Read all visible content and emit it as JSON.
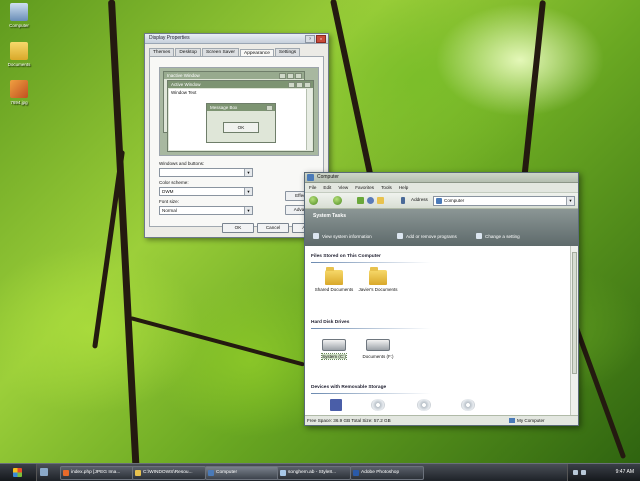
{
  "desktop": {
    "icons": [
      {
        "label": "Computer",
        "name": "computer-icon"
      },
      {
        "label": "Documents",
        "name": "documents-icon"
      },
      {
        "label": "7694.jpg",
        "name": "image-file-icon"
      }
    ]
  },
  "display_dialog": {
    "title": "Display Properties",
    "tabs": [
      "Themes",
      "Desktop",
      "Screen Saver",
      "Appearance",
      "Settings"
    ],
    "active_tab": "Appearance",
    "preview": {
      "inactive_title": "Inactive Window",
      "active_title": "Active Window",
      "window_text": "Window Text",
      "message_title": "Message Box",
      "ok": "OK"
    },
    "fields": {
      "windows_buttons_label": "Windows and buttons:",
      "windows_buttons_value": "",
      "color_scheme_label": "Color scheme:",
      "color_scheme_value": "DWM",
      "font_size_label": "Font size:",
      "font_size_value": "Normal"
    },
    "effects_label": "Effects...",
    "advanced_label": "Advanced",
    "ok": "OK",
    "cancel": "Cancel",
    "apply": "Apply"
  },
  "computer_window": {
    "title": "Computer",
    "menu": [
      "File",
      "Edit",
      "View",
      "Favorites",
      "Tools",
      "Help"
    ],
    "address_label": "Address",
    "address_value": "Computer",
    "system_tasks": {
      "heading": "System Tasks",
      "items": [
        "View system information",
        "Add or remove programs",
        "Change a setting"
      ]
    },
    "sections": {
      "files_heading": "Files Stored on This Computer",
      "files": [
        "Shared Documents",
        "Javier's Documents"
      ],
      "drives_heading": "Hard Disk Drives",
      "drives": [
        "System (C:)",
        "Documents (F:)"
      ],
      "removable_heading": "Devices with Removable Storage"
    },
    "status_left": "Free Space: 36.9 GB Total Size: 57.2 GB",
    "status_right": "My Computer"
  },
  "taskbar": {
    "buttons": [
      "index.php [JPEG Ima...",
      "C:\\WINDOWS\\Resou...",
      "Computer",
      "songhem.ab - Style8...",
      "Adobe Photoshop"
    ],
    "active_index": 2,
    "clock": "9:47 AM"
  }
}
